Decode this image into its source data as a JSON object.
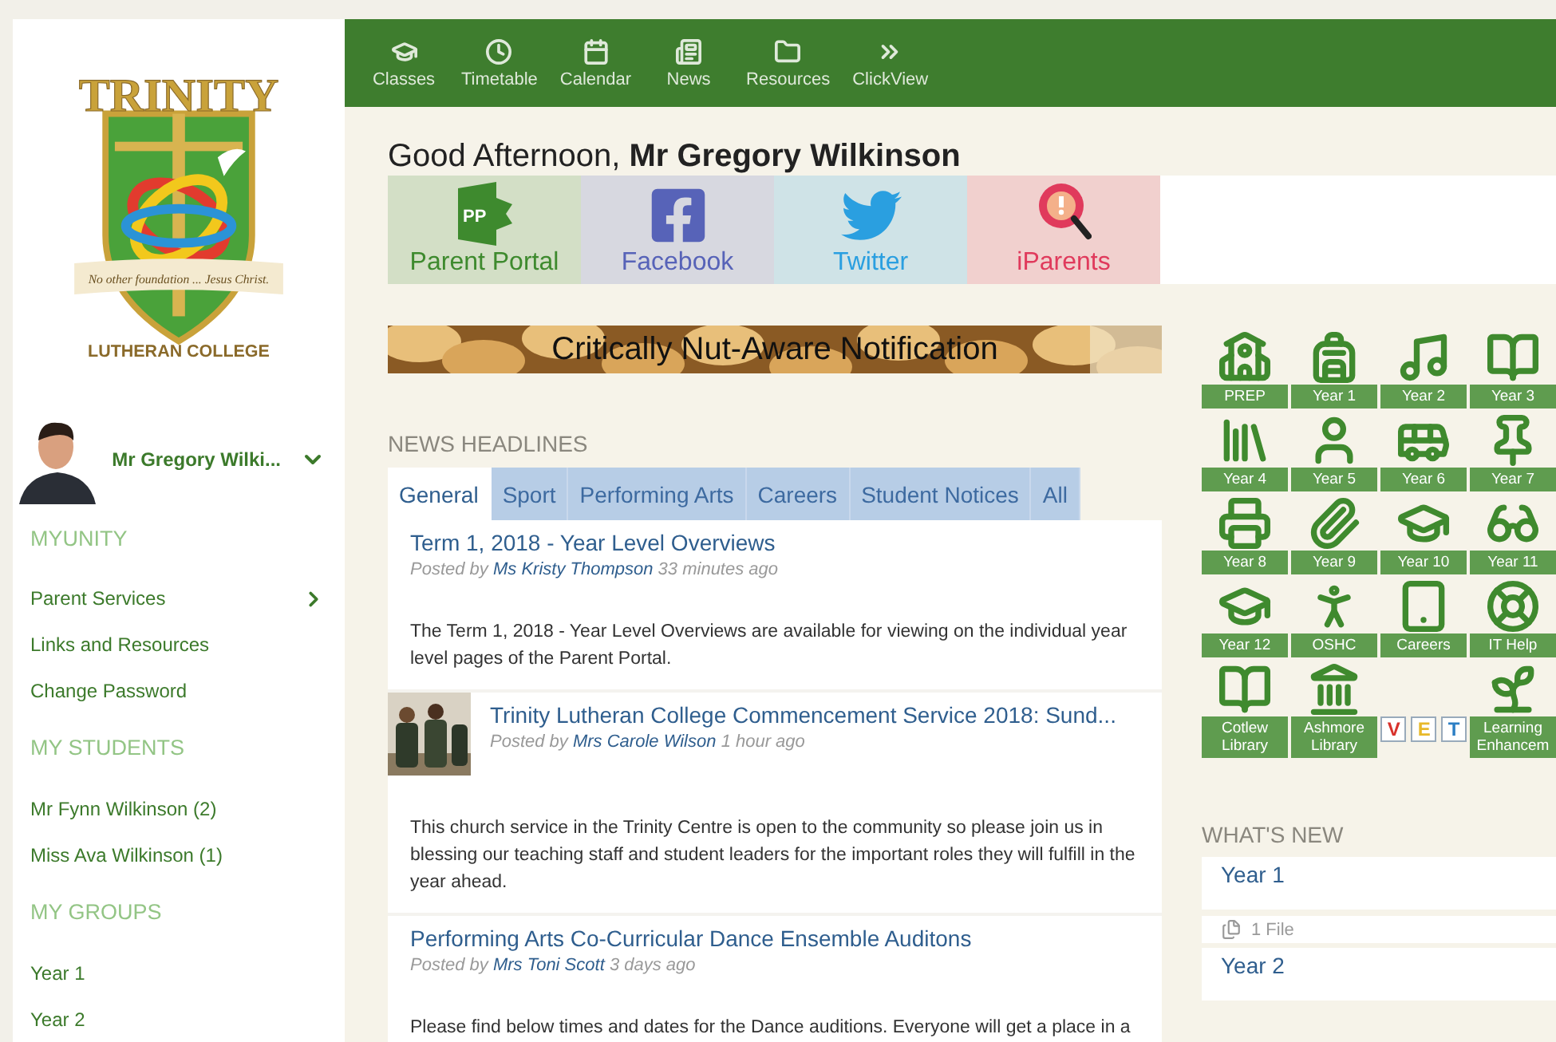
{
  "sidebar": {
    "logo": {
      "title": "TRINITY",
      "motto": "No other foundation ... Jesus Christ.",
      "subtitle": "LUTHERAN COLLEGE"
    },
    "user": {
      "name": "Mr Gregory Wilki..."
    },
    "sections": [
      {
        "heading": "MYUNITY",
        "items": [
          {
            "label": "Parent Services",
            "has_submenu": true
          },
          {
            "label": "Links and Resources",
            "has_submenu": false
          },
          {
            "label": "Change Password",
            "has_submenu": false
          }
        ]
      },
      {
        "heading": "MY STUDENTS",
        "items": [
          {
            "label": "Mr Fynn Wilkinson (2)",
            "has_submenu": false
          },
          {
            "label": "Miss Ava Wilkinson (1)",
            "has_submenu": false
          }
        ]
      },
      {
        "heading": "MY GROUPS",
        "items": [
          {
            "label": "Year 1",
            "has_submenu": false
          },
          {
            "label": "Year 2",
            "has_submenu": false
          }
        ]
      }
    ]
  },
  "nav": [
    {
      "label": "Classes"
    },
    {
      "label": "Timetable"
    },
    {
      "label": "Calendar"
    },
    {
      "label": "News"
    },
    {
      "label": "Resources"
    },
    {
      "label": "ClickView"
    }
  ],
  "greeting": "Good Afternoon, **Mr Gregory Wilkinson**",
  "quick_links": [
    {
      "label": "Parent Portal",
      "color": "#3e8a2e",
      "icon_text": "PP"
    },
    {
      "label": "Facebook",
      "color": "#5763b8"
    },
    {
      "label": "Twitter",
      "color": "#2a9fe0"
    },
    {
      "label": "iParents",
      "color": "#e03a5c"
    }
  ],
  "notice": {
    "title": "Critically Nut-Aware Notification"
  },
  "news": {
    "heading": "NEWS HEADLINES",
    "tabs": [
      {
        "label": "General",
        "selected": true
      },
      {
        "label": "Sport",
        "selected": false
      },
      {
        "label": "Performing Arts",
        "selected": false
      },
      {
        "label": "Careers",
        "selected": false
      },
      {
        "label": "Student Notices",
        "selected": false
      },
      {
        "label": "All",
        "selected": false
      }
    ],
    "articles": [
      {
        "title": "Term 1, 2018 - Year Level Overviews",
        "byline": "Posted by",
        "author": "Ms Kristy Thompson",
        "time": "33 minutes ago",
        "body": "The Term 1, 2018 - Year Level Overviews are available for viewing on the individual year level pages of the Parent Portal.",
        "thumbnail": false
      },
      {
        "title": "Trinity Lutheran College Commencement Service 2018: Sund...",
        "byline": "Posted by",
        "author": "Mrs Carole Wilson",
        "time": "1 hour ago",
        "body": "This church service in the Trinity Centre is open to the community so please join us in blessing our teaching staff and student leaders for the important roles they will fulfill in the year ahead.",
        "thumbnail": true
      },
      {
        "title": "Performing Arts Co-Curricular Dance Ensemble Auditons",
        "byline": "Posted by",
        "author": "Mrs Toni Scott",
        "time": "3 days ago",
        "body": "Please find below times and dates for the Dance auditions. Everyone will get a place in a",
        "thumbnail": false
      }
    ]
  },
  "year_tiles": [
    {
      "kind": "tile",
      "label": "PREP"
    },
    {
      "kind": "tile",
      "label": "Year 1"
    },
    {
      "kind": "tile",
      "label": "Year 2"
    },
    {
      "kind": "tile",
      "label": "Year 3"
    },
    {
      "kind": "tile",
      "label": "Year 4"
    },
    {
      "kind": "tile",
      "label": "Year 5"
    },
    {
      "kind": "tile",
      "label": "Year 6"
    },
    {
      "kind": "tile",
      "label": "Year 7"
    },
    {
      "kind": "tile",
      "label": "Year 8"
    },
    {
      "kind": "tile",
      "label": "Year 9"
    },
    {
      "kind": "tile",
      "label": "Year 10"
    },
    {
      "kind": "tile",
      "label": "Year 11"
    },
    {
      "kind": "tile",
      "label": "Year 12"
    },
    {
      "kind": "tile",
      "label": "OSHC"
    },
    {
      "kind": "tile",
      "label": "Careers"
    },
    {
      "kind": "tile",
      "label": "IT Help"
    },
    {
      "kind": "tile",
      "label": "Cotlew Library"
    },
    {
      "kind": "tile",
      "label": "Ashmore Library"
    },
    {
      "kind": "logo",
      "letters": [
        {
          "text": "V",
          "color": "#d8322c"
        },
        {
          "text": "E",
          "color": "#e8b92a"
        },
        {
          "text": "T",
          "color": "#2c7fc4"
        }
      ]
    },
    {
      "kind": "tile",
      "label": "Learning Enhancem"
    }
  ],
  "whats_new": {
    "heading": "WHAT'S NEW",
    "items": [
      {
        "title": "Year 1",
        "files": "1 File"
      },
      {
        "title": "Year 2"
      }
    ]
  }
}
